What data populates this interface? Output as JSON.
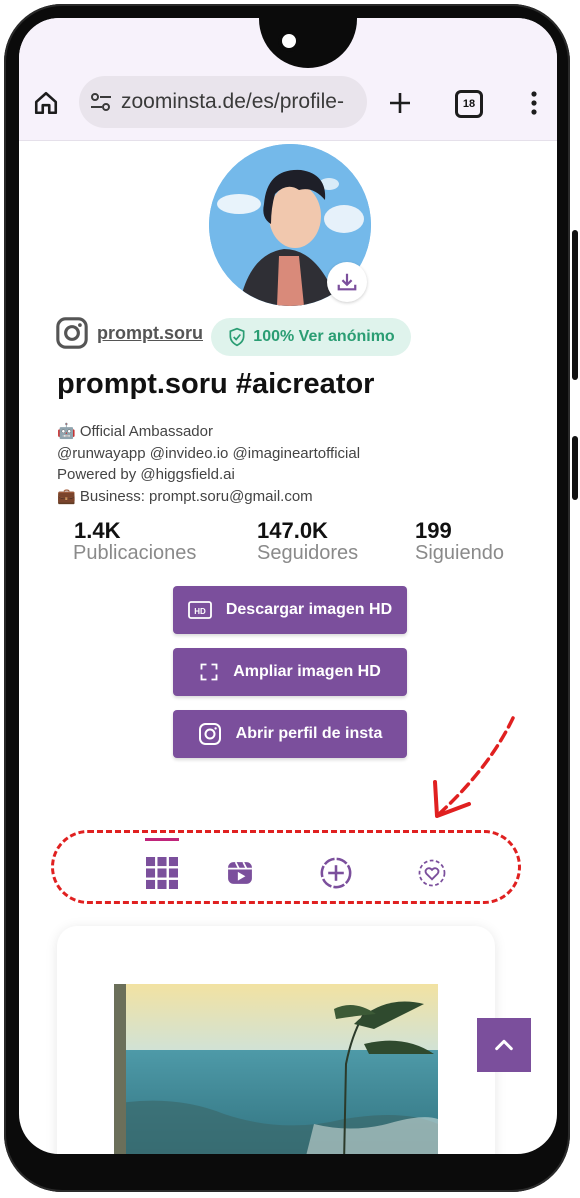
{
  "browser": {
    "url": "zoominsta.de/es/profile-",
    "tab_count": "18"
  },
  "profile": {
    "handle": "prompt.soru",
    "anon_badge": "100% Ver anónimo",
    "display_name": "prompt.soru #aicreator",
    "bio_lines": [
      "🤖 Official Ambassador",
      "@runwayapp @invideo.io @imagineartofficial",
      "Powered by @higgsfield.ai",
      "💼 Business: prompt.soru@gmail.com"
    ]
  },
  "stats": [
    {
      "value": "1.4K",
      "label": "Publicaciones"
    },
    {
      "value": "147.0K",
      "label": "Seguidores"
    },
    {
      "value": "199",
      "label": "Siguiendo"
    }
  ],
  "actions": {
    "download_hd": "Descargar imagen HD",
    "zoom_hd": "Ampliar imagen HD",
    "open_profile": "Abrir perfil de insta"
  },
  "colors": {
    "accent": "#7b4f9c",
    "badge_green": "#2a9d73",
    "annotation_red": "#e02020"
  },
  "icons": [
    "home-icon",
    "site-settings-icon",
    "new-tab-icon",
    "tab-switcher-icon",
    "menu-icon",
    "instagram-icon",
    "shield-check-icon",
    "download-icon",
    "hd-icon",
    "expand-icon",
    "grid-icon",
    "reels-icon",
    "add-circle-icon",
    "tagged-icon",
    "chevron-up-icon"
  ]
}
